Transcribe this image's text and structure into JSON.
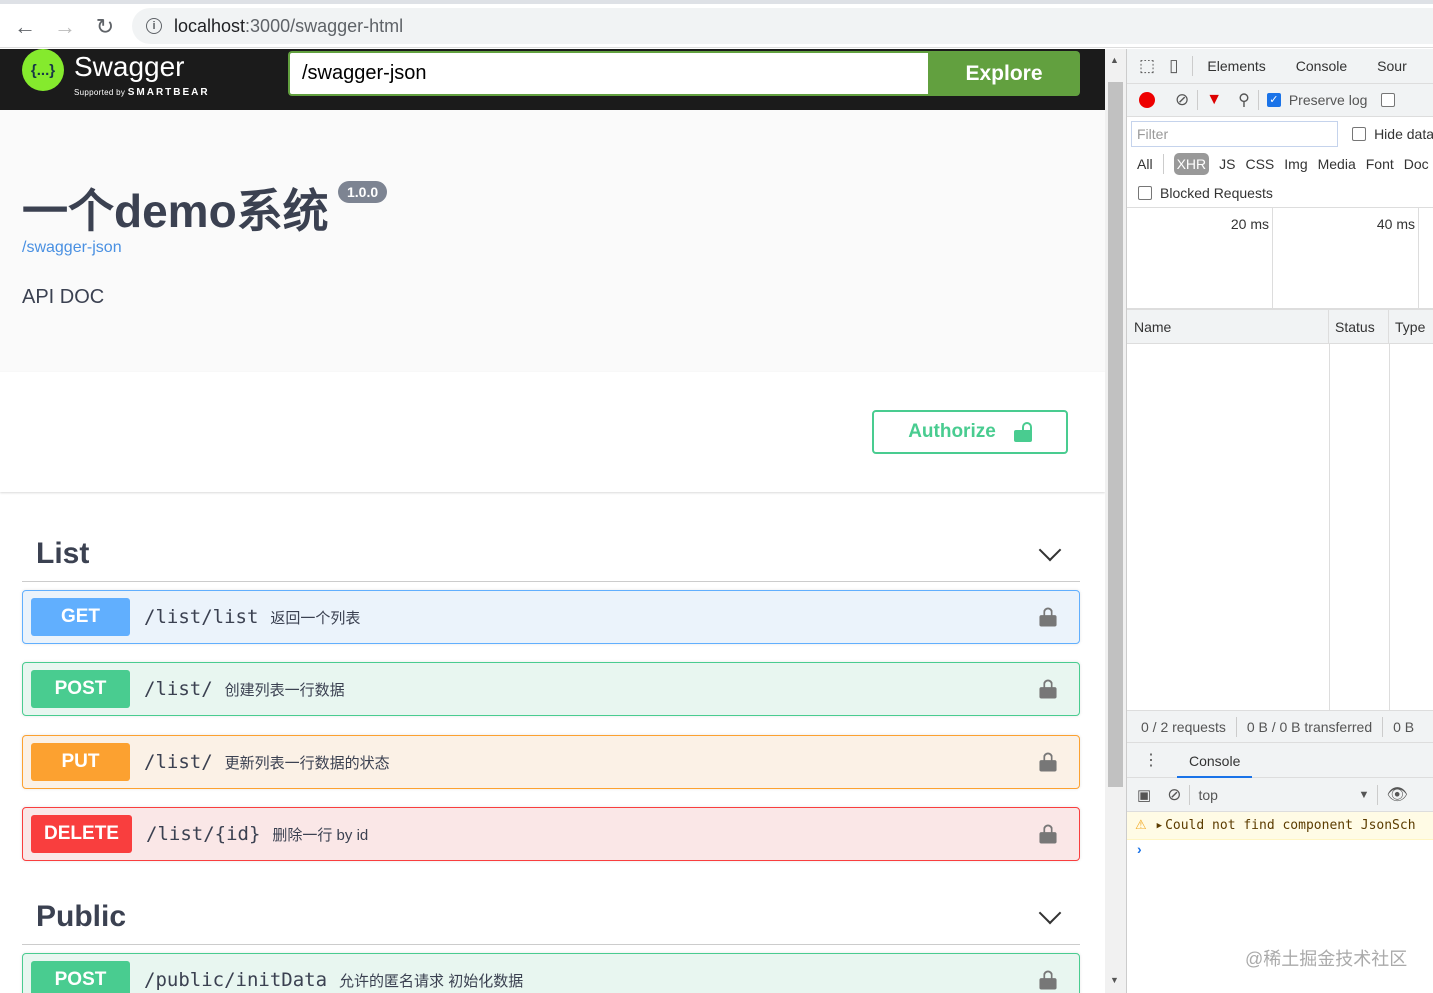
{
  "browser": {
    "url_host": "localhost",
    "url_rest": ":3000/swagger-html"
  },
  "topbar": {
    "brand": "Swagger",
    "supported": "Supported by",
    "smartbear": "SMARTBEAR",
    "url_value": "/swagger-json",
    "explore": "Explore",
    "logo": "{...}"
  },
  "info": {
    "title": "一个demo系统",
    "version": "1.0.0",
    "link": "/swagger-json",
    "description": "API DOC"
  },
  "authorize": "Authorize",
  "tags": [
    {
      "name": "List",
      "ops": [
        {
          "method": "GET",
          "path": "/list/list",
          "summary": "返回一个列表"
        },
        {
          "method": "POST",
          "path": "/list/",
          "summary": "创建列表一行数据"
        },
        {
          "method": "PUT",
          "path": "/list/",
          "summary": "更新列表一行数据的状态"
        },
        {
          "method": "DELETE",
          "path": "/list/{id}",
          "summary": "删除一行 by id"
        }
      ]
    },
    {
      "name": "Public",
      "ops": [
        {
          "method": "POST",
          "path": "/public/initData",
          "summary": "允许的匿名请求 初始化数据"
        }
      ]
    }
  ],
  "devtools": {
    "tabs": [
      "Elements",
      "Console",
      "Sour"
    ],
    "preserve_log": "Preserve log",
    "filter_placeholder": "Filter",
    "hide_data": "Hide data",
    "types": [
      "All",
      "XHR",
      "JS",
      "CSS",
      "Img",
      "Media",
      "Font",
      "Doc"
    ],
    "blocked": "Blocked Requests",
    "timeline": [
      "20 ms",
      "40 ms"
    ],
    "columns": [
      "Name",
      "Status",
      "Type"
    ],
    "status": [
      "0 / 2 requests",
      "0 B / 0 B transferred",
      "0 B"
    ],
    "drawer_tab": "Console",
    "context": "top",
    "warning": "Could not find component JsonSch",
    "watermark": "@稀土掘金技术社区"
  }
}
